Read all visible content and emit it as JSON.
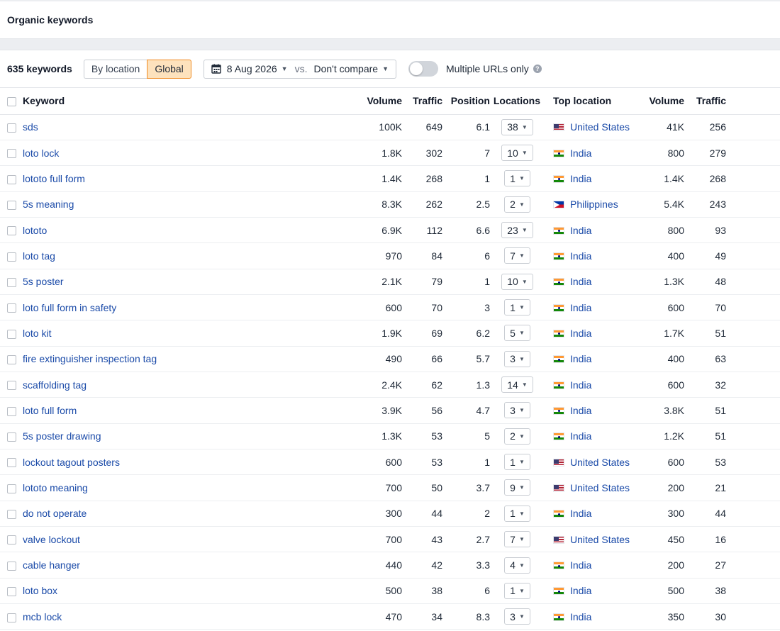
{
  "header": {
    "title": "Organic keywords"
  },
  "toolbar": {
    "count": "635 keywords",
    "by_location": "By location",
    "global": "Global",
    "date": "8 Aug 2026",
    "vs": "vs.",
    "compare": "Don't compare",
    "multiple_urls": "Multiple URLs only",
    "help": "?"
  },
  "table": {
    "headers": {
      "keyword": "Keyword",
      "volume": "Volume",
      "traffic": "Traffic",
      "position": "Position",
      "locations": "Locations",
      "top_location": "Top location",
      "volume2": "Volume",
      "traffic2": "Traffic"
    },
    "rows": [
      {
        "keyword": "sds",
        "volume": "100K",
        "traffic": "649",
        "position": "6.1",
        "locations": "38",
        "flag": "us",
        "country": "United States",
        "loc_volume": "41K",
        "loc_traffic": "256"
      },
      {
        "keyword": "loto lock",
        "volume": "1.8K",
        "traffic": "302",
        "position": "7",
        "locations": "10",
        "flag": "in",
        "country": "India",
        "loc_volume": "800",
        "loc_traffic": "279"
      },
      {
        "keyword": "lototo full form",
        "volume": "1.4K",
        "traffic": "268",
        "position": "1",
        "locations": "1",
        "flag": "in",
        "country": "India",
        "loc_volume": "1.4K",
        "loc_traffic": "268"
      },
      {
        "keyword": "5s meaning",
        "volume": "8.3K",
        "traffic": "262",
        "position": "2.5",
        "locations": "2",
        "flag": "ph",
        "country": "Philippines",
        "loc_volume": "5.4K",
        "loc_traffic": "243"
      },
      {
        "keyword": "lototo",
        "volume": "6.9K",
        "traffic": "112",
        "position": "6.6",
        "locations": "23",
        "flag": "in",
        "country": "India",
        "loc_volume": "800",
        "loc_traffic": "93"
      },
      {
        "keyword": "loto tag",
        "volume": "970",
        "traffic": "84",
        "position": "6",
        "locations": "7",
        "flag": "in",
        "country": "India",
        "loc_volume": "400",
        "loc_traffic": "49"
      },
      {
        "keyword": "5s poster",
        "volume": "2.1K",
        "traffic": "79",
        "position": "1",
        "locations": "10",
        "flag": "in",
        "country": "India",
        "loc_volume": "1.3K",
        "loc_traffic": "48"
      },
      {
        "keyword": "loto full form in safety",
        "volume": "600",
        "traffic": "70",
        "position": "3",
        "locations": "1",
        "flag": "in",
        "country": "India",
        "loc_volume": "600",
        "loc_traffic": "70"
      },
      {
        "keyword": "loto kit",
        "volume": "1.9K",
        "traffic": "69",
        "position": "6.2",
        "locations": "5",
        "flag": "in",
        "country": "India",
        "loc_volume": "1.7K",
        "loc_traffic": "51"
      },
      {
        "keyword": "fire extinguisher inspection tag",
        "volume": "490",
        "traffic": "66",
        "position": "5.7",
        "locations": "3",
        "flag": "in",
        "country": "India",
        "loc_volume": "400",
        "loc_traffic": "63"
      },
      {
        "keyword": "scaffolding tag",
        "volume": "2.4K",
        "traffic": "62",
        "position": "1.3",
        "locations": "14",
        "flag": "in",
        "country": "India",
        "loc_volume": "600",
        "loc_traffic": "32"
      },
      {
        "keyword": "loto full form",
        "volume": "3.9K",
        "traffic": "56",
        "position": "4.7",
        "locations": "3",
        "flag": "in",
        "country": "India",
        "loc_volume": "3.8K",
        "loc_traffic": "51"
      },
      {
        "keyword": "5s poster drawing",
        "volume": "1.3K",
        "traffic": "53",
        "position": "5",
        "locations": "2",
        "flag": "in",
        "country": "India",
        "loc_volume": "1.2K",
        "loc_traffic": "51"
      },
      {
        "keyword": "lockout tagout posters",
        "volume": "600",
        "traffic": "53",
        "position": "1",
        "locations": "1",
        "flag": "us",
        "country": "United States",
        "loc_volume": "600",
        "loc_traffic": "53"
      },
      {
        "keyword": "lototo meaning",
        "volume": "700",
        "traffic": "50",
        "position": "3.7",
        "locations": "9",
        "flag": "us",
        "country": "United States",
        "loc_volume": "200",
        "loc_traffic": "21"
      },
      {
        "keyword": "do not operate",
        "volume": "300",
        "traffic": "44",
        "position": "2",
        "locations": "1",
        "flag": "in",
        "country": "India",
        "loc_volume": "300",
        "loc_traffic": "44"
      },
      {
        "keyword": "valve lockout",
        "volume": "700",
        "traffic": "43",
        "position": "2.7",
        "locations": "7",
        "flag": "us",
        "country": "United States",
        "loc_volume": "450",
        "loc_traffic": "16"
      },
      {
        "keyword": "cable hanger",
        "volume": "440",
        "traffic": "42",
        "position": "3.3",
        "locations": "4",
        "flag": "in",
        "country": "India",
        "loc_volume": "200",
        "loc_traffic": "27"
      },
      {
        "keyword": "loto box",
        "volume": "500",
        "traffic": "38",
        "position": "6",
        "locations": "1",
        "flag": "in",
        "country": "India",
        "loc_volume": "500",
        "loc_traffic": "38"
      },
      {
        "keyword": "mcb lock",
        "volume": "470",
        "traffic": "34",
        "position": "8.3",
        "locations": "3",
        "flag": "in",
        "country": "India",
        "loc_volume": "350",
        "loc_traffic": "30"
      }
    ]
  }
}
